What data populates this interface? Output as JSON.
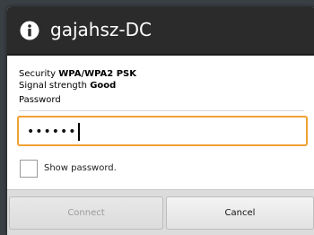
{
  "dialog": {
    "title": "gajahsz-DC",
    "title_icon": "info-icon",
    "security_label": "Security",
    "security_value": "WPA/WPA2 PSK",
    "signal_label": "Signal strength",
    "signal_value": "Good",
    "password_label": "Password",
    "password_value": "••••••",
    "show_password_label": "Show password.",
    "show_password_checked": false,
    "connect_label": "Connect",
    "connect_enabled": false,
    "cancel_label": "Cancel",
    "accent_color": "#f0a030"
  }
}
